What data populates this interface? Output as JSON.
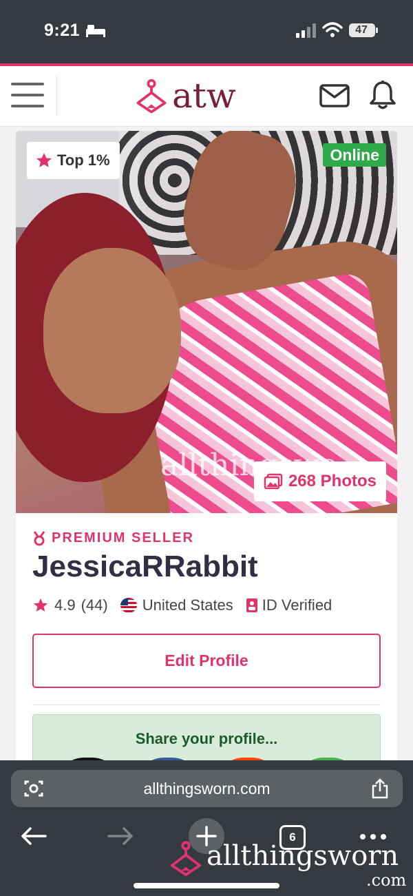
{
  "status_bar": {
    "time": "9:21",
    "battery": "47"
  },
  "header": {
    "logo_text": "atw"
  },
  "profile": {
    "top_badge": "Top 1%",
    "online_badge": "Online",
    "photos_badge": "268 Photos",
    "photo_watermark": "allthingswo",
    "seller_tier": "PREMIUM SELLER",
    "username": "JessicaRRabbit",
    "rating": "4.9",
    "review_count": "(44)",
    "country": "United States",
    "verification": "ID Verified",
    "edit_button": "Edit Profile",
    "share_title": "Share your profile..."
  },
  "browser": {
    "url": "allthingsworn.com",
    "tab_count": "6",
    "watermark_text": "allthingsworn",
    "watermark_suffix": ".com"
  },
  "colors": {
    "accent": "#e0336d",
    "online": "#2eaa4a",
    "share_bg": "#d8ecda",
    "chrome": "#343a3f"
  },
  "share_buttons": [
    "#111111",
    "#3b5998",
    "#ff4500",
    "#4caf50"
  ]
}
